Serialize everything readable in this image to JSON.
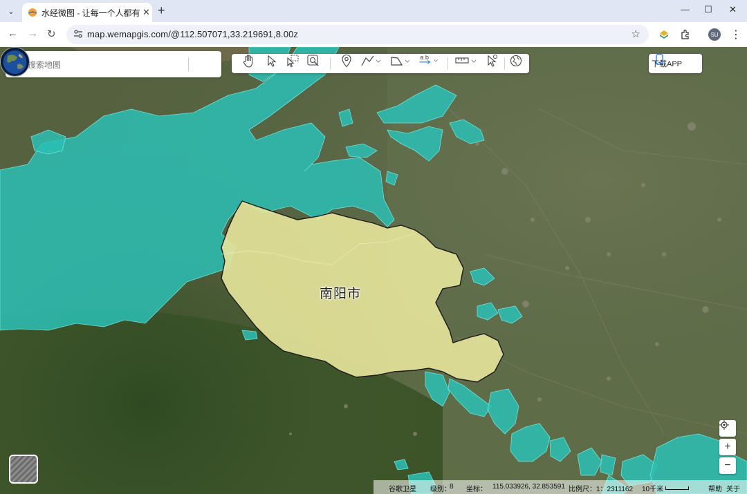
{
  "browser": {
    "tab_title": "水经微图 - 让每一个人都有自己",
    "tab_close": "✕",
    "new_tab": "+",
    "url": "map.wemapgis.com/@112.507071,33.219691,8.00z",
    "min": "—",
    "max": "☐",
    "close": "✕",
    "profile": "SU"
  },
  "search": {
    "placeholder": "搜索地图"
  },
  "download_label": "下载APP",
  "map": {
    "city_label": "南阳市",
    "colors": {
      "highlight": "#e7e59b",
      "overlay": "#2bbfb5"
    }
  },
  "zoom": {
    "in": "+",
    "out": "−"
  },
  "status": {
    "source": "谷歌卫星",
    "level_label": "级别：",
    "level": "8",
    "coord_label": "坐标：",
    "coord": "115.033926, 32.853591",
    "scale_label": "比例尺：",
    "scale": "1：2311162",
    "distance": "10千米",
    "help": "帮助",
    "about": "关于"
  }
}
